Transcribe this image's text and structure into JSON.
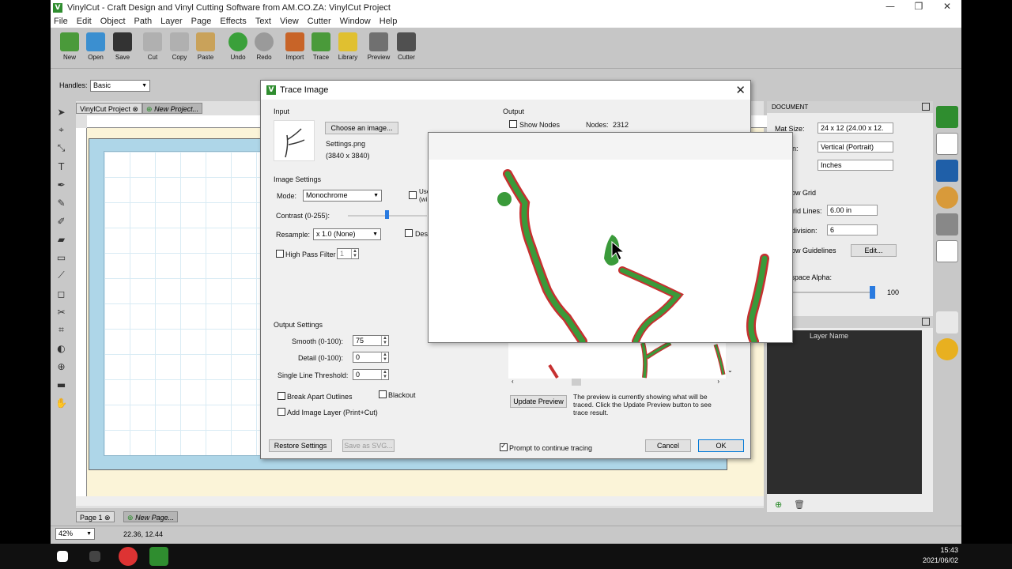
{
  "window": {
    "title": "VinylCut - Craft Design and Vinyl Cutting Software from AM.CO.ZA: VinylCut Project",
    "minimize": "—",
    "maximize": "❐",
    "close": "✕"
  },
  "menu": [
    "File",
    "Edit",
    "Object",
    "Path",
    "Layer",
    "Page",
    "Effects",
    "Text",
    "View",
    "Cutter",
    "Window",
    "Help"
  ],
  "toolbar": [
    {
      "label": "New",
      "icon": "new-icon",
      "color": "#4a9a3a"
    },
    {
      "label": "Open",
      "icon": "open-icon",
      "color": "#3b8fd0"
    },
    {
      "label": "Save",
      "icon": "save-icon",
      "color": "#333333"
    },
    {
      "label": "Cut",
      "icon": "cut-icon",
      "color": "#b0b0b0"
    },
    {
      "label": "Copy",
      "icon": "copy-icon",
      "color": "#b0b0b0"
    },
    {
      "label": "Paste",
      "icon": "paste-icon",
      "color": "#c9a25a"
    },
    {
      "label": "Undo",
      "icon": "undo-icon",
      "color": "#3aa03a"
    },
    {
      "label": "Redo",
      "icon": "redo-icon",
      "color": "#9a9a9a"
    },
    {
      "label": "Import",
      "icon": "import-icon",
      "color": "#c86428"
    },
    {
      "label": "Trace",
      "icon": "trace-icon",
      "color": "#4a9a3a"
    },
    {
      "label": "Library",
      "icon": "library-icon",
      "color": "#e0c030"
    },
    {
      "label": "Preview",
      "icon": "preview-icon",
      "color": "#707070"
    },
    {
      "label": "Cutter",
      "icon": "cutter-icon",
      "color": "#505050"
    }
  ],
  "options": {
    "handles_label": "Handles:",
    "handles_value": "Basic"
  },
  "tabs": {
    "project": "VinylCut Project",
    "new_project": "New Project...",
    "page1": "Page 1",
    "new_page": "New Page..."
  },
  "status": {
    "zoom": "42%",
    "coords": "22.36, 12.44"
  },
  "doc_panel": {
    "header": "DOCUMENT",
    "mat_size_label": "Mat Size:",
    "mat_size_value": "24 x 12 (24.00 x 12.",
    "orientation_label": "ntation:",
    "orientation_value": "Vertical (Portrait)",
    "units_label": ":",
    "units_value": "Inches",
    "show_grid": "how Grid",
    "grid_lines_label": "Grid Lines:",
    "grid_lines_value": "6.00 in",
    "subdivision_label": "bdivision:",
    "subdivision_value": "6",
    "show_guidelines": "how Guidelines",
    "edit_btn": "Edit...",
    "workspace_alpha_label": "kspace Alpha:",
    "workspace_alpha_value": "100",
    "layers_header": "S",
    "layer_name_col": "Layer Name"
  },
  "dialog": {
    "title": "Trace Image",
    "input_label": "Input",
    "choose_image": "Choose an image...",
    "file_name": "Settings.png",
    "file_size": "(3840 x 3840)",
    "image_settings": "Image Settings",
    "mode_label": "Mode:",
    "mode_value": "Monochrome",
    "use_label": "Use",
    "use_sub": "(wi",
    "contrast_label": "Contrast (0-255):",
    "resample_label": "Resample:",
    "resample_value": "x 1.0 (None)",
    "despeckle": "Desp",
    "high_pass": "High Pass Filter",
    "high_pass_value": "1",
    "output_settings": "Output Settings",
    "smooth_label": "Smooth (0-100):",
    "smooth_value": "75",
    "detail_label": "Detail (0-100):",
    "detail_value": "0",
    "single_line_label": "Single Line Threshold:",
    "single_line_value": "0",
    "break_apart": "Break Apart Outlines",
    "blackout": "Blackout",
    "add_image_layer": "Add Image Layer (Print+Cut)",
    "restore": "Restore Settings",
    "save_svg": "Save as SVG...",
    "output_label": "Output",
    "show_nodes": "Show Nodes",
    "nodes_label": "Nodes:",
    "nodes_value": "2312",
    "update_preview": "Update Preview",
    "preview_note": "The preview is currently showing what will be traced. Click the Update Preview button to see trace result.",
    "prompt_continue": "Prompt to continue tracing",
    "cancel": "Cancel",
    "ok": "OK"
  },
  "taskbar": {
    "time": "15:43",
    "date": "2021/06/02"
  }
}
